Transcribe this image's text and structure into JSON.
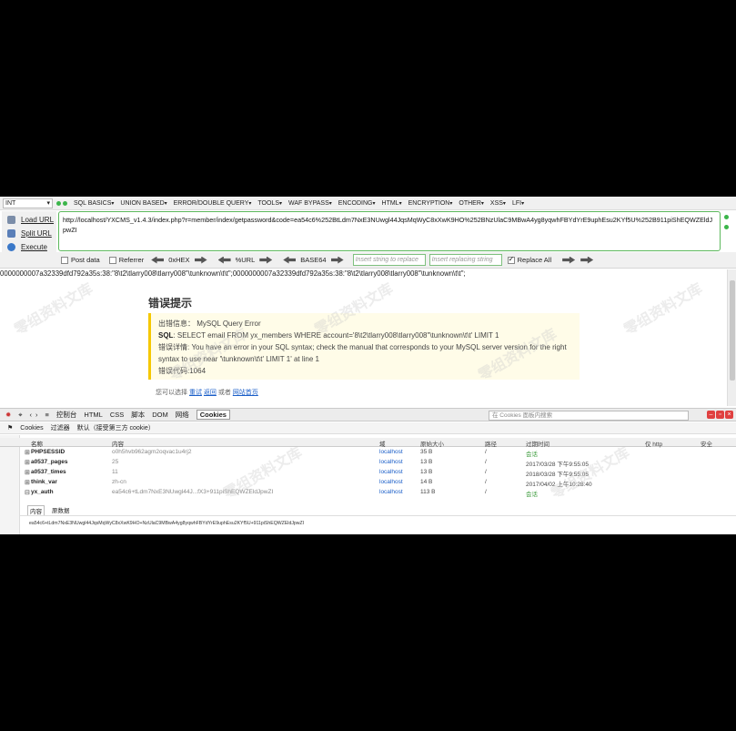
{
  "hackbar": {
    "select": "INT",
    "menus": [
      "SQL BASICS",
      "UNION BASED",
      "ERROR/DOUBLE QUERY",
      "TOOLS",
      "WAF BYPASS",
      "ENCODING",
      "HTML",
      "ENCRYPTION",
      "OTHER",
      "XSS",
      "LFI"
    ],
    "actions": {
      "load": "Load URL",
      "split": "Split URL",
      "execute": "Execute"
    },
    "url": "http://localhost/YXCMS_v1.4.3/index.php?r=member/index/getpassword&code=ea54c6%252BtLdm7NxE3NUwgl44JqsMqWyC8xXwK9HO%252BNzUlaC9MBwA4yg8yqwhFBYdYrE9uphEsu2KYf5U%252B911piShEQWZEldJpwZI",
    "post_data": "Post data",
    "referrer": "Referrer",
    "hex": "0xHEX",
    "url_enc": "%URL",
    "base64": "BASE64",
    "replace_placeholder": "Insert string to replace",
    "replacing_placeholder": "Insert replacing string",
    "replace_all": "Replace All"
  },
  "page": {
    "echo": "0000000007a32339dfd792a35s:38:\"8\\t2\\tlarry008\\tlarry008\"\\tunknown\\t\\t\";0000000007a32339dfd792a35s:38:\"8\\t2\\tlarry008\\tlarry008\"\\tunknown\\t\\t\";",
    "error_title": "错误提示",
    "err_info_label": "出错信息：",
    "err_info": "MySQL Query Error",
    "sql_label": "SQL",
    "sql": ": SELECT email FROM yx_members WHERE account='8\\t2\\tlarry008\\tlarry008\"\\tunknown\\t\\t' LIMIT 1",
    "detail_label": "错误详情:",
    "detail": " You have an error in your SQL syntax; check the manual that corresponds to your MySQL server version for the right syntax to use near '\\tunknown\\t\\t' LIMIT 1' at line 1",
    "code_label": "错误代码:",
    "code": "1064",
    "links_prefix": "您可以选择",
    "link_retry": "重试",
    "link_back": "返回",
    "or": "或者",
    "link_home": "网站首页"
  },
  "devtools": {
    "tabs": [
      "控制台",
      "HTML",
      "CSS",
      "脚本",
      "DOM",
      "网络",
      "Cookies"
    ],
    "search_placeholder": "在 Cookies 面板内搜索",
    "subbar": [
      "Cookies",
      "过滤器",
      "默认（接受第三方 cookie）"
    ],
    "columns": {
      "name": "名称",
      "value": "内容",
      "domain": "域",
      "size": "原始大小",
      "path": "路径",
      "expires": "过期时间",
      "http": "仅 http",
      "secure": "安全"
    },
    "rows": [
      {
        "name": "PHPSESSID",
        "value": "o0h5hvb962agm2oqvac1u4rj2",
        "domain": "localhost",
        "size": "35 B",
        "path": "/",
        "expires": "会话"
      },
      {
        "name": "a0537_pages",
        "value": "25",
        "domain": "localhost",
        "size": "13 B",
        "path": "/",
        "expires": "2017/03/28 下午9:55:05"
      },
      {
        "name": "a0537_times",
        "value": "11",
        "domain": "localhost",
        "size": "13 B",
        "path": "/",
        "expires": "2018/03/28 下午9:55:05"
      },
      {
        "name": "think_var",
        "value": "zh-cn",
        "domain": "localhost",
        "size": "14 B",
        "path": "/",
        "expires": "2017/04/02 上午10:28:40"
      },
      {
        "name": "yx_auth",
        "value": "ea54c6+tLdm7NxE3NUwgl44J...fX3+911piShEQWZEldJpwZI",
        "domain": "localhost",
        "size": "113 B",
        "path": "/",
        "expires": "会话"
      }
    ],
    "detail_tabs": [
      "内容",
      "原数据"
    ],
    "detail_value": "ea54c6+tLdm7NxE3NUwgl44JqsMqWyC8xXwK9HO+NzUlaC9MBwA4yg8yqwhFBYdYrE9uphEsu2KYf5U+911piShEQWZEldJpwZI"
  },
  "watermark": "零组资料文库",
  "colors": {
    "accent_green": "#3bb54a",
    "link_blue": "#1a5ec8",
    "error_bar": "#f5c800"
  }
}
